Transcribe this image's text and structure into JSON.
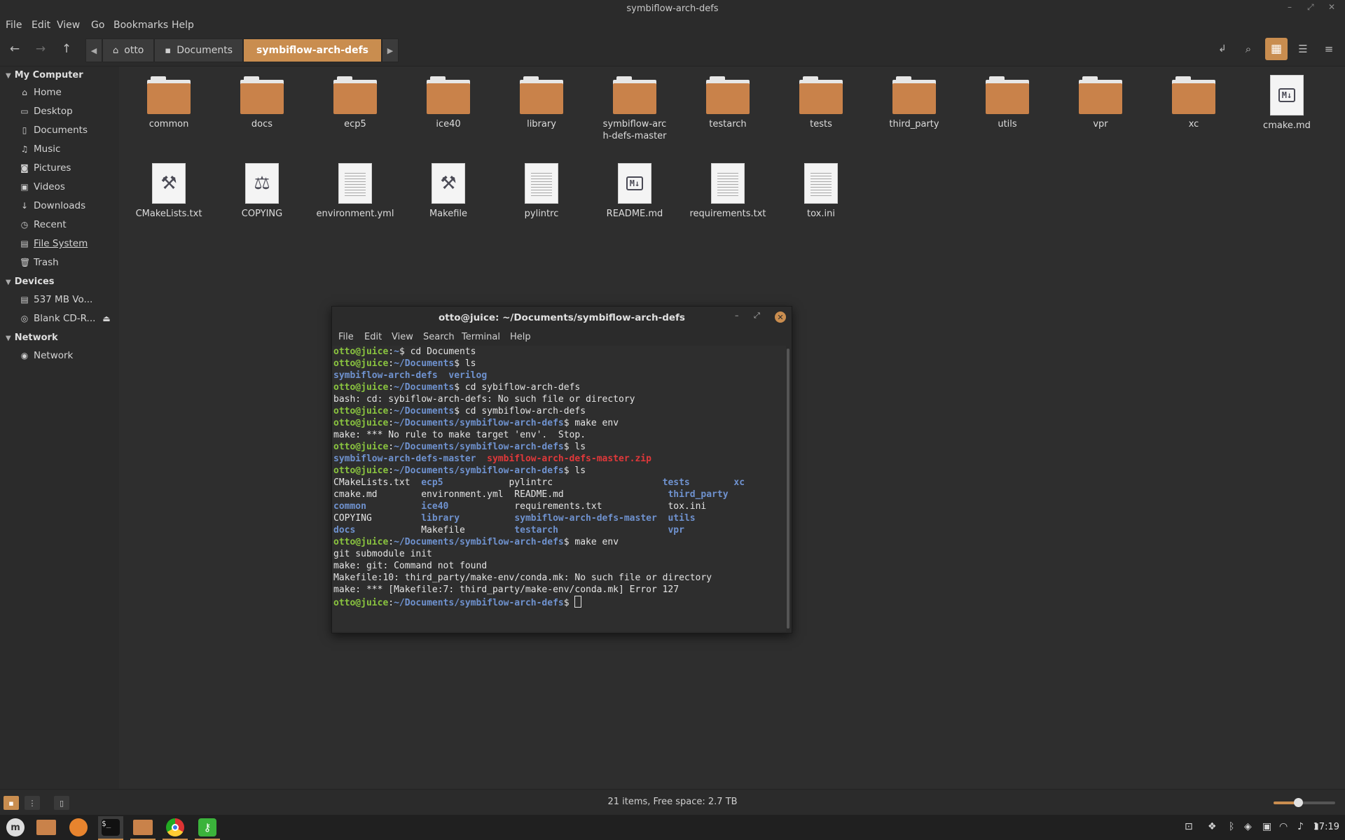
{
  "window": {
    "title": "symbiflow-arch-defs"
  },
  "menu": [
    "File",
    "Edit",
    "View",
    "Go",
    "Bookmarks",
    "Help"
  ],
  "breadcrumbs": {
    "home": "otto",
    "middle": "Documents",
    "current": "symbiflow-arch-defs"
  },
  "sidebar": {
    "my_computer": "My Computer",
    "places": [
      "Home",
      "Desktop",
      "Documents",
      "Music",
      "Pictures",
      "Videos",
      "Downloads",
      "Recent",
      "File System",
      "Trash"
    ],
    "devices_header": "Devices",
    "devices": [
      "537 MB Vo...",
      "Blank CD-R..."
    ],
    "network_header": "Network",
    "network": [
      "Network"
    ]
  },
  "files": [
    {
      "name": "common",
      "kind": "folder"
    },
    {
      "name": "docs",
      "kind": "folder"
    },
    {
      "name": "ecp5",
      "kind": "folder"
    },
    {
      "name": "ice40",
      "kind": "folder"
    },
    {
      "name": "library",
      "kind": "folder"
    },
    {
      "name": "symbiflow-arch-defs-master",
      "kind": "folder"
    },
    {
      "name": "testarch",
      "kind": "folder"
    },
    {
      "name": "tests",
      "kind": "folder"
    },
    {
      "name": "third_party",
      "kind": "folder"
    },
    {
      "name": "utils",
      "kind": "folder"
    },
    {
      "name": "vpr",
      "kind": "folder"
    },
    {
      "name": "xc",
      "kind": "folder"
    },
    {
      "name": "cmake.md",
      "kind": "markdown"
    },
    {
      "name": "CMakeLists.txt",
      "kind": "build"
    },
    {
      "name": "COPYING",
      "kind": "license"
    },
    {
      "name": "environment.yml",
      "kind": "text"
    },
    {
      "name": "Makefile",
      "kind": "build"
    },
    {
      "name": "pylintrc",
      "kind": "text"
    },
    {
      "name": "README.md",
      "kind": "markdown"
    },
    {
      "name": "requirements.txt",
      "kind": "text"
    },
    {
      "name": "tox.ini",
      "kind": "text"
    }
  ],
  "status": {
    "text": "21 items, Free space: 2.7 TB",
    "zoom_level": 0.4
  },
  "terminal": {
    "title": "otto@juice: ~/Documents/symbiflow-arch-defs",
    "menu": [
      "File",
      "Edit",
      "View",
      "Search",
      "Terminal",
      "Help"
    ],
    "lines": [
      [
        {
          "t": "otto@juice",
          "c": "pg"
        },
        {
          "t": ":"
        },
        {
          "t": "~",
          "c": "pb"
        },
        {
          "t": "$ cd Documents"
        }
      ],
      [
        {
          "t": "otto@juice",
          "c": "pg"
        },
        {
          "t": ":"
        },
        {
          "t": "~/Documents",
          "c": "pb"
        },
        {
          "t": "$ ls"
        }
      ],
      [
        {
          "t": "symbiflow-arch-defs",
          "c": "dr"
        },
        {
          "t": "  "
        },
        {
          "t": "verilog",
          "c": "dr"
        }
      ],
      [
        {
          "t": "otto@juice",
          "c": "pg"
        },
        {
          "t": ":"
        },
        {
          "t": "~/Documents",
          "c": "pb"
        },
        {
          "t": "$ cd sybiflow-arch-defs"
        }
      ],
      [
        {
          "t": "bash: cd: sybiflow-arch-defs: No such file or directory"
        }
      ],
      [
        {
          "t": "otto@juice",
          "c": "pg"
        },
        {
          "t": ":"
        },
        {
          "t": "~/Documents",
          "c": "pb"
        },
        {
          "t": "$ cd symbiflow-arch-defs"
        }
      ],
      [
        {
          "t": "otto@juice",
          "c": "pg"
        },
        {
          "t": ":"
        },
        {
          "t": "~/Documents/symbiflow-arch-defs",
          "c": "pb"
        },
        {
          "t": "$ make env"
        }
      ],
      [
        {
          "t": "make: *** No rule to make target 'env'.  Stop."
        }
      ],
      [
        {
          "t": "otto@juice",
          "c": "pg"
        },
        {
          "t": ":"
        },
        {
          "t": "~/Documents/symbiflow-arch-defs",
          "c": "pb"
        },
        {
          "t": "$ ls"
        }
      ],
      [
        {
          "t": "symbiflow-arch-defs-master",
          "c": "dr"
        },
        {
          "t": "  "
        },
        {
          "t": "symbiflow-arch-defs-master.zip",
          "c": "zr"
        }
      ],
      [
        {
          "t": "otto@juice",
          "c": "pg"
        },
        {
          "t": ":"
        },
        {
          "t": "~/Documents/symbiflow-arch-defs",
          "c": "pb"
        },
        {
          "t": "$ ls"
        }
      ],
      [
        {
          "t": "CMakeLists.txt  "
        },
        {
          "t": "ecp5",
          "c": "dr"
        },
        {
          "t": "            pylintrc                    "
        },
        {
          "t": "tests",
          "c": "dr"
        },
        {
          "t": "        "
        },
        {
          "t": "xc",
          "c": "dr"
        }
      ],
      [
        {
          "t": "cmake.md        environment.yml  README.md                   "
        },
        {
          "t": "third_party",
          "c": "dr"
        }
      ],
      [
        {
          "t": "common",
          "c": "dr"
        },
        {
          "t": "          "
        },
        {
          "t": "ice40",
          "c": "dr"
        },
        {
          "t": "            requirements.txt            tox.ini"
        }
      ],
      [
        {
          "t": "COPYING         "
        },
        {
          "t": "library",
          "c": "dr"
        },
        {
          "t": "          "
        },
        {
          "t": "symbiflow-arch-defs-master",
          "c": "dr"
        },
        {
          "t": "  "
        },
        {
          "t": "utils",
          "c": "dr"
        }
      ],
      [
        {
          "t": "docs",
          "c": "dr"
        },
        {
          "t": "            Makefile         "
        },
        {
          "t": "testarch",
          "c": "dr"
        },
        {
          "t": "                    "
        },
        {
          "t": "vpr",
          "c": "dr"
        }
      ],
      [
        {
          "t": "otto@juice",
          "c": "pg"
        },
        {
          "t": ":"
        },
        {
          "t": "~/Documents/symbiflow-arch-defs",
          "c": "pb"
        },
        {
          "t": "$ make env"
        }
      ],
      [
        {
          "t": "git submodule init"
        }
      ],
      [
        {
          "t": "make: git: Command not found"
        }
      ],
      [
        {
          "t": "Makefile:10: third_party/make-env/conda.mk: No such file or directory"
        }
      ],
      [
        {
          "t": "make: *** [Makefile:7: third_party/make-env/conda.mk] Error 127"
        }
      ],
      [
        {
          "t": "otto@juice",
          "c": "pg"
        },
        {
          "t": ":"
        },
        {
          "t": "~/Documents/symbiflow-arch-defs",
          "c": "pb"
        },
        {
          "t": "$ "
        }
      ]
    ]
  },
  "clock": "17:19"
}
